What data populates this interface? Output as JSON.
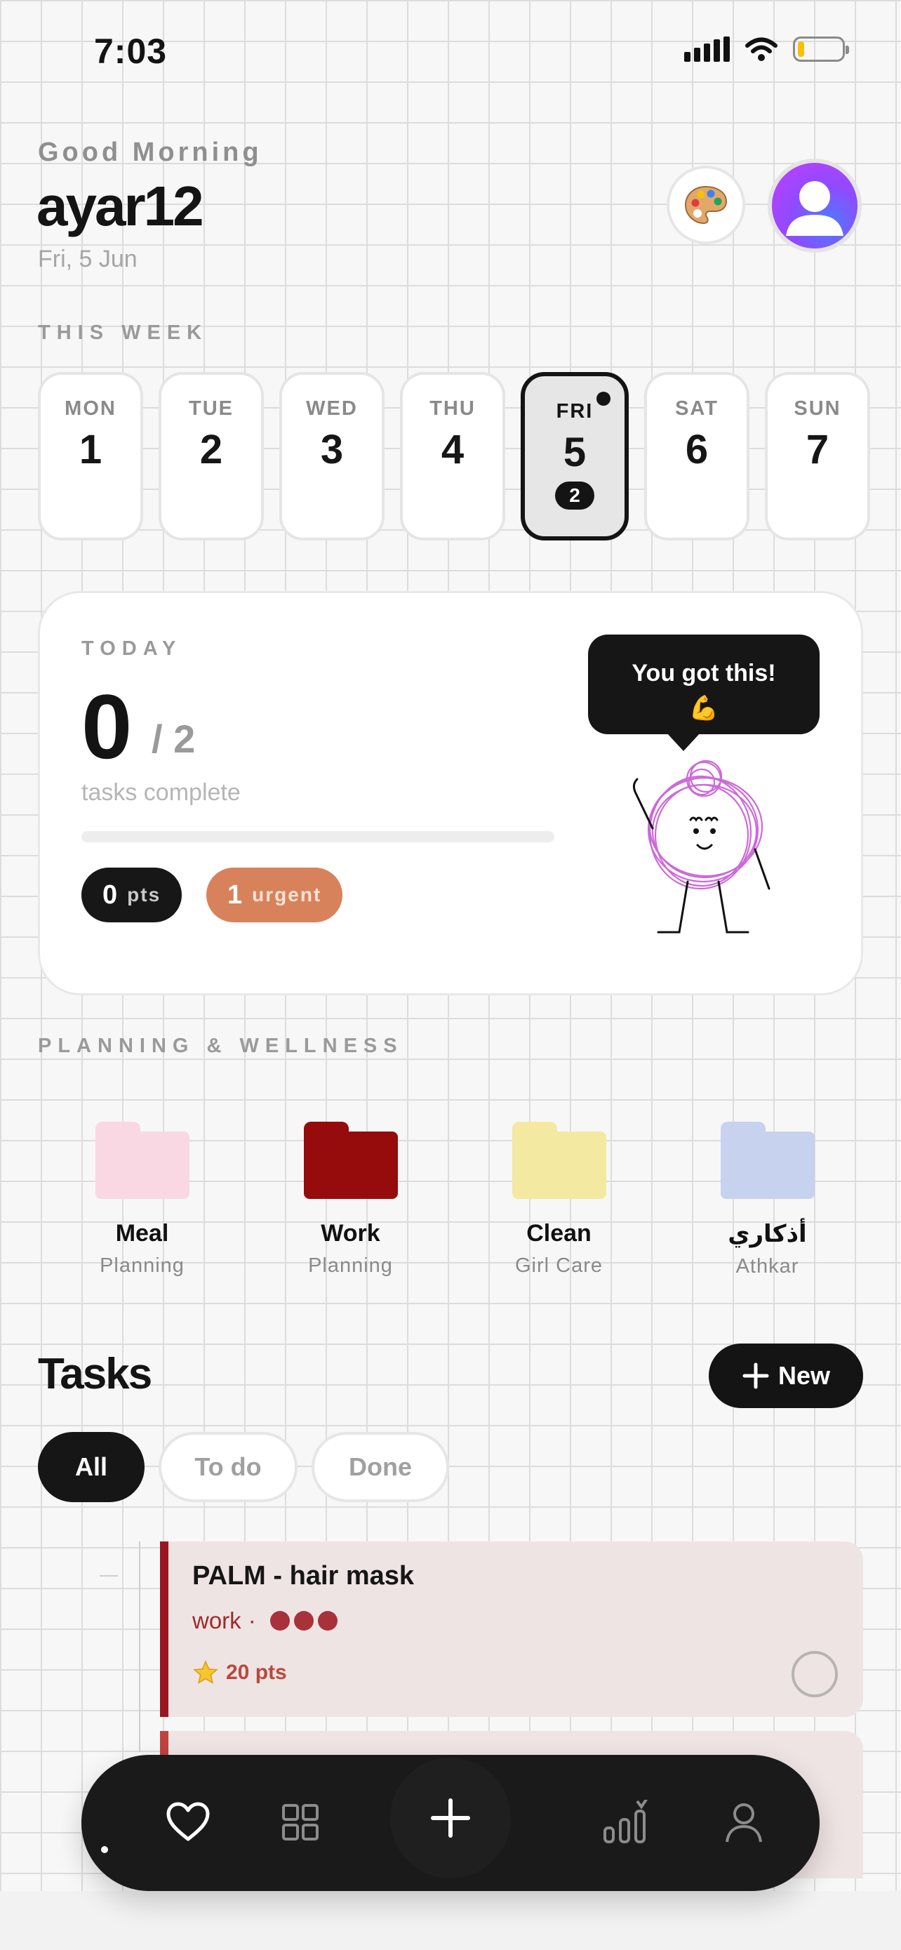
{
  "status_bar": {
    "time": "7:03",
    "signal": "signal-icon",
    "wifi": "wifi-icon",
    "battery": "battery-low-icon"
  },
  "header": {
    "greeting": "Good Morning",
    "username": "ayar12",
    "date": "Fri, 5 Jun",
    "palette_icon": "palette-icon",
    "avatar_icon": "user-avatar-icon"
  },
  "week": {
    "label": "THIS WEEK",
    "days": [
      {
        "name": "MON",
        "num": "1"
      },
      {
        "name": "TUE",
        "num": "2"
      },
      {
        "name": "WED",
        "num": "3"
      },
      {
        "name": "THU",
        "num": "4"
      },
      {
        "name": "FRI",
        "num": "5",
        "count": "2",
        "selected": true
      },
      {
        "name": "SAT",
        "num": "6"
      },
      {
        "name": "SUN",
        "num": "7"
      }
    ]
  },
  "today": {
    "label": "TODAY",
    "done": "0",
    "total": "/ 2",
    "subtitle": "tasks complete",
    "progress": 0,
    "points": "0",
    "points_unit": "pts",
    "urgent": "1",
    "urgent_unit": "urgent",
    "bubble_text": "You got this!",
    "bubble_emoji": "💪",
    "mascot": "doodle-mascot"
  },
  "planning": {
    "label": "PLANNING & WELLNESS",
    "folders": [
      {
        "title": "Meal",
        "subtitle": "Planning",
        "color": "#f9d8e3"
      },
      {
        "title": "Work",
        "subtitle": "Planning",
        "color": "#960b0b"
      },
      {
        "title": "Clean",
        "subtitle": "Girl Care",
        "color": "#f3e9a0"
      },
      {
        "title": "أذكاري",
        "subtitle": "Athkar",
        "color": "#c6d2ee"
      }
    ]
  },
  "tasks": {
    "title": "Tasks",
    "new_label": "New",
    "filters": [
      "All",
      "To do",
      "Done"
    ],
    "active_filter": "All",
    "items": [
      {
        "name": "PALM - hair mask",
        "category": "work",
        "separator": "·",
        "priority": 3,
        "points": "20 pts",
        "accent": "#9b1620",
        "done": false
      }
    ]
  },
  "tabbar": {
    "items": [
      "heart-icon",
      "grid-icon",
      "plus-icon",
      "stats-icon",
      "profile-icon"
    ],
    "active": "heart-icon"
  },
  "colors": {
    "dark": "#141414",
    "urgent": "#d8825c",
    "task_bg": "#efe4e4",
    "work_red": "#960b0b"
  }
}
